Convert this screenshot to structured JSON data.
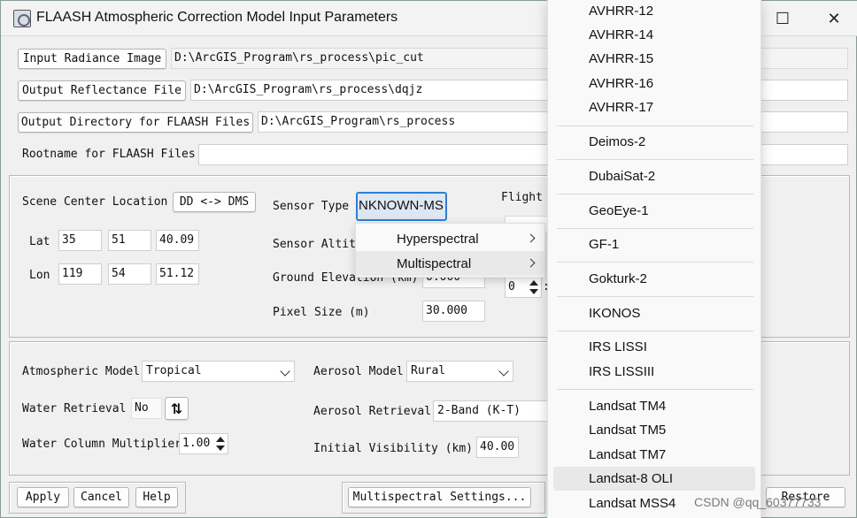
{
  "window": {
    "title": "FLAASH Atmospheric Correction Model Input Parameters",
    "maximize_glyph": "☐",
    "close_glyph": "✕"
  },
  "files": {
    "input_radiance_label": "Input Radiance Image",
    "input_radiance_value": "D:\\ArcGIS_Program\\rs_process\\pic_cut",
    "output_reflectance_label": "Output Reflectance File",
    "output_reflectance_value": "D:\\ArcGIS_Program\\rs_process\\dqjz",
    "output_dir_label": "Output Directory for FLAASH Files",
    "output_dir_value": "D:\\ArcGIS_Program\\rs_process",
    "rootname_label": "Rootname for FLAASH Files",
    "rootname_value": ""
  },
  "scene": {
    "center_label": "Scene Center Location",
    "dd_dms_label": "DD <-> DMS",
    "lat_label": "Lat",
    "lat": [
      "35",
      "51",
      "40.09"
    ],
    "lon_label": "Lon",
    "lon": [
      "119",
      "54",
      "51.12"
    ],
    "sensor_type_label": "Sensor Type",
    "sensor_type_value": "NKNOWN-MS",
    "sensor_altitude_label": "Sensor Altitu",
    "ground_elevation_label": "Ground Elevation (km)",
    "ground_elevation_value": "0.000",
    "pixel_size_label": "Pixel Size (m)",
    "pixel_size_value": "30.000",
    "flight_label": "Flight",
    "flight_value": "0"
  },
  "atmos": {
    "model_label": "Atmospheric Model",
    "model_value": "Tropical",
    "water_retrieval_label": "Water Retrieval",
    "water_retrieval_value": "No",
    "water_col_label": "Water Column Multiplier",
    "water_col_value": "1.00",
    "aerosol_model_label": "Aerosol Model",
    "aerosol_model_value": "Rural",
    "aerosol_retrieval_label": "Aerosol Retrieval",
    "aerosol_retrieval_value": "2-Band (K-T)",
    "visibility_label": "Initial Visibility (km)",
    "visibility_value": "40.00"
  },
  "footer": {
    "apply": "Apply",
    "cancel": "Cancel",
    "help": "Help",
    "multispectral": "Multispectral Settings...",
    "restore": "Restore"
  },
  "sensor_menu": {
    "items": [
      "Hyperspectral",
      "Multispectral"
    ]
  },
  "sensor_list": {
    "items": [
      "AVHRR-12",
      "AVHRR-14",
      "AVHRR-15",
      "AVHRR-16",
      "AVHRR-17",
      "Deimos-2",
      "DubaiSat-2",
      "GeoEye-1",
      "GF-1",
      "Gokturk-2",
      "IKONOS",
      "IRS LISSI",
      "IRS LISSIII",
      "Landsat TM4",
      "Landsat TM5",
      "Landsat TM7",
      "Landsat-8 OLI",
      "Landsat MSS4"
    ],
    "highlighted": "Landsat-8 OLI"
  },
  "watermark": "CSDN @qq_60377733",
  "colors": {
    "window_bg": "#f0f0f0",
    "menu_bg": "#f9f9f9",
    "highlight": "#e8e8e8",
    "sensor_field_border": "#2b7fd6"
  }
}
